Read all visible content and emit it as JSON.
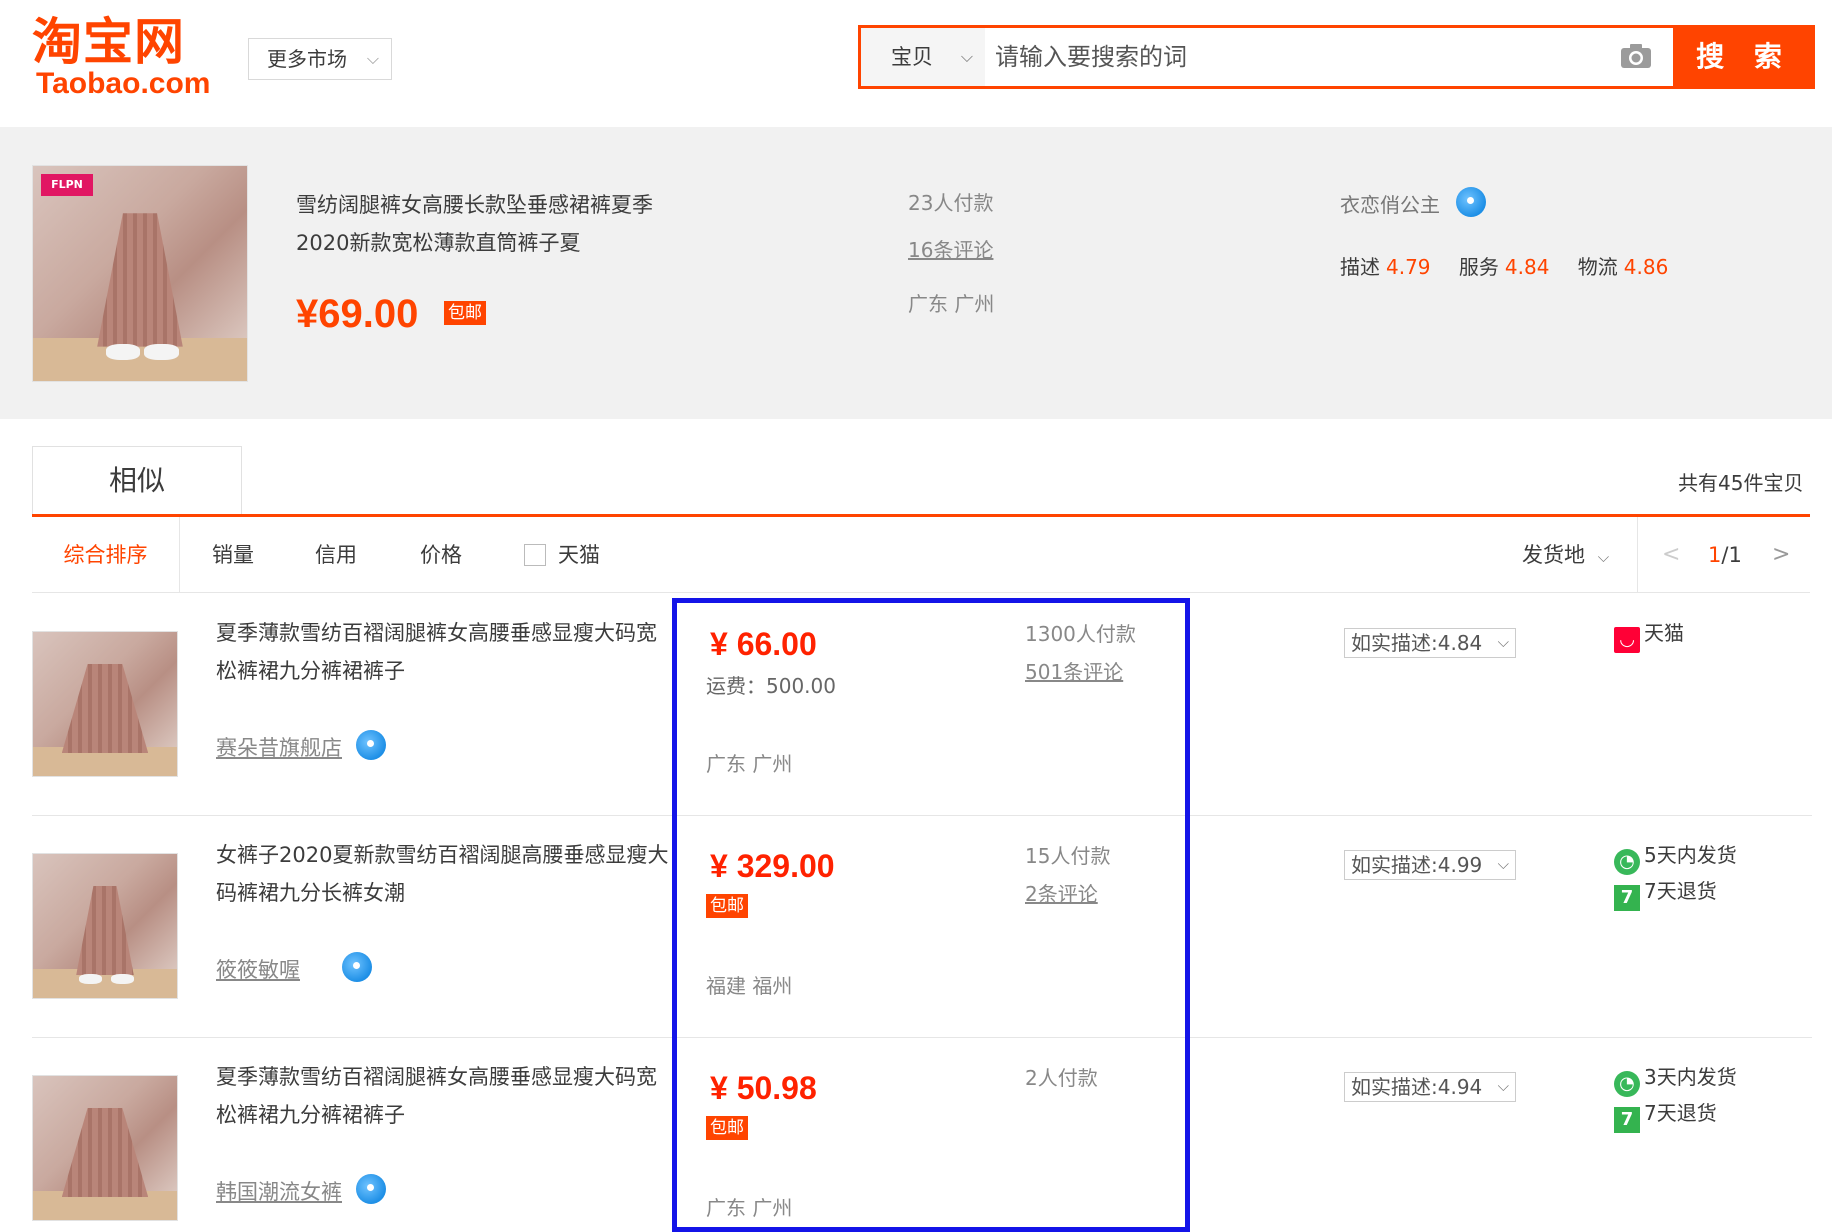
{
  "header": {
    "logo_cn": "淘宝网",
    "logo_en": "Taobao.com",
    "market_label": "更多市场",
    "search_category": "宝贝",
    "search_placeholder": "请输入要搜索的词",
    "search_button": "搜 索"
  },
  "main_item": {
    "title": "雪纺阔腿裤女高腰长款坠垂感裙裤夏季2020新款宽松薄款直筒裤子夏",
    "price": "¥69.00",
    "free_shipping": "包邮",
    "paid_count": "23人付款",
    "reviews": "16条评论",
    "location": "广东 广州",
    "seller": "衣恋俏公主",
    "scores": [
      {
        "label": "描述",
        "value": "4.79"
      },
      {
        "label": "服务",
        "value": "4.84"
      },
      {
        "label": "物流",
        "value": "4.86"
      }
    ]
  },
  "tabs": {
    "similar": "相似",
    "total": "共有45件宝贝"
  },
  "sortbar": {
    "default": "综合排序",
    "sales": "销量",
    "credit": "信用",
    "price": "价格",
    "tmall": "天猫",
    "ship_from": "发货地",
    "page_current": "1",
    "page_total": "/1"
  },
  "results": [
    {
      "title": "夏季薄款雪纺百褶阔腿裤女高腰垂感显瘦大码宽松裤裙九分裤裙裤子",
      "shop": "赛朵昔旗舰店",
      "price": "¥ 66.00",
      "shipping_fee": "运费：500.00",
      "location": "广东 广州",
      "paid_count": "1300人付款",
      "reviews": "501条评论",
      "rating": "如实描述:4.84",
      "services": [
        {
          "icon": "tmall-icon",
          "text": "天猫"
        }
      ]
    },
    {
      "title": "女裤子2020夏新款雪纺百褶阔腿高腰垂感显瘦大码裤裙九分长裤女潮",
      "shop": "筱筱敏喔",
      "price": "¥ 329.00",
      "free_shipping": "包邮",
      "location": "福建 福州",
      "paid_count": "15人付款",
      "reviews": "2条评论",
      "rating": "如实描述:4.99",
      "services": [
        {
          "icon": "clock-icon",
          "text": "5天内发货"
        },
        {
          "icon": "seven-day-icon",
          "text": "7天退货"
        }
      ]
    },
    {
      "title": "夏季薄款雪纺百褶阔腿裤女高腰垂感显瘦大码宽松裤裙九分裤裙裤子",
      "shop": "韩国潮流女裤",
      "price": "¥ 50.98",
      "free_shipping": "包邮",
      "location": "广东 广州",
      "paid_count": "2人付款",
      "rating": "如实描述:4.94",
      "services": [
        {
          "icon": "clock-icon",
          "text": "3天内发货"
        },
        {
          "icon": "seven-day-icon",
          "text": "7天退货"
        }
      ]
    }
  ],
  "colors": {
    "accent": "#ff4400",
    "price_red": "#ff2200",
    "highlight": "#1414e8"
  }
}
